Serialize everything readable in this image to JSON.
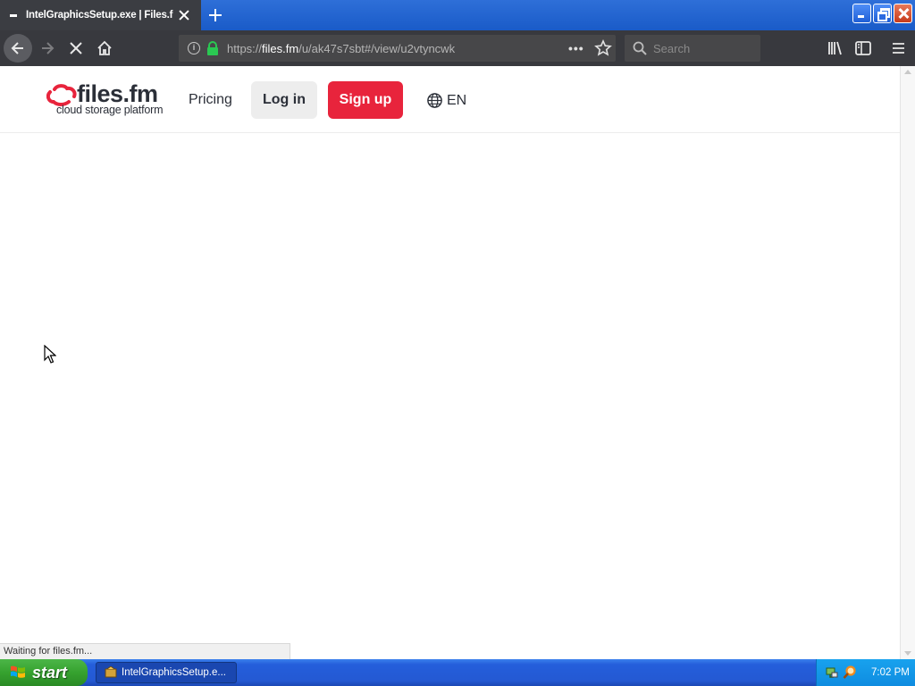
{
  "browser": {
    "tab_title": "IntelGraphicsSetup.exe | Files.fm.",
    "url_prefix": "https://",
    "url_domain": "files.fm",
    "url_path": "/u/ak47s7sbt#/view/u2vtyncwk",
    "search_placeholder": "Search",
    "status_text": "Waiting for files.fm..."
  },
  "site": {
    "logo_text": "files.fm",
    "logo_tagline": "cloud storage platform",
    "nav_pricing": "Pricing",
    "login_label": "Log in",
    "signup_label": "Sign up",
    "language": "EN",
    "brand_color": "#e8243c"
  },
  "taskbar": {
    "start_label": "start",
    "task_item_label": "IntelGraphicsSetup.e...",
    "clock": "7:02 PM"
  },
  "icons": [
    "back-arrow-icon",
    "forward-arrow-icon",
    "stop-icon",
    "home-icon",
    "info-icon",
    "lock-icon",
    "page-actions-icon",
    "bookmark-star-icon",
    "search-icon",
    "library-icon",
    "sidebar-icon",
    "hamburger-menu-icon",
    "globe-icon",
    "windows-flag-icon",
    "network-icon",
    "magnifier-icon"
  ]
}
